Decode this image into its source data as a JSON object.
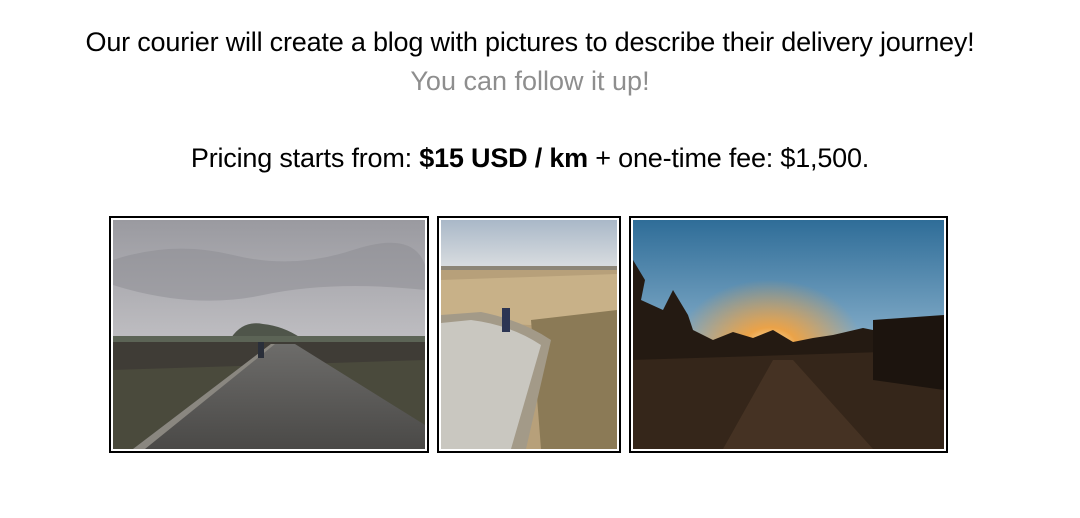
{
  "intro": {
    "headline": "Our courier will create a blog with pictures to describe their delivery journey!",
    "subline": "You can follow it up!",
    "subline_color": "#8e8e8e"
  },
  "pricing": {
    "prefix": "Pricing starts from: ",
    "rate": "$15 USD / km",
    "suffix": " + one-time fee: $1,500."
  },
  "gallery": {
    "photos": [
      {
        "subject": "walker-on-country-road-cloudy"
      },
      {
        "subject": "hiker-on-path-through-fields"
      },
      {
        "subject": "sunset-through-trees"
      }
    ]
  }
}
